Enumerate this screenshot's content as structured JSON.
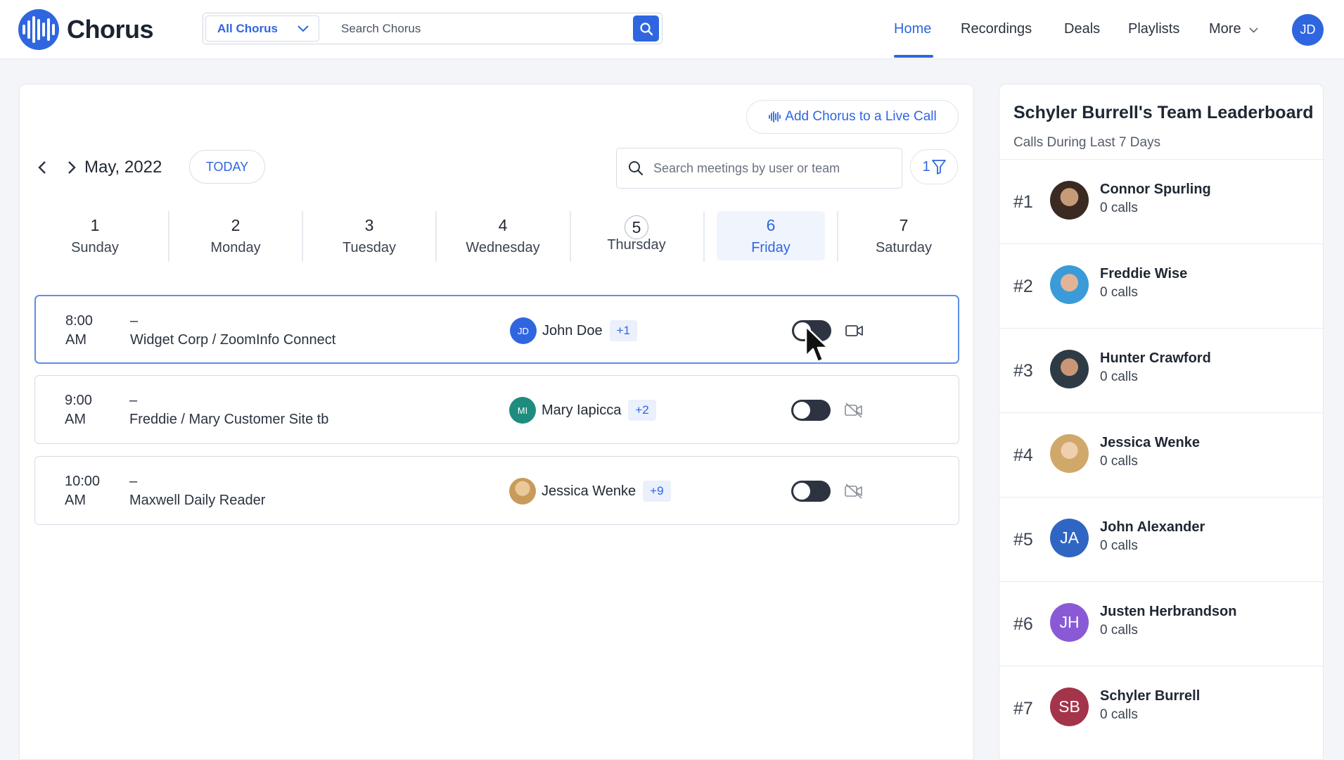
{
  "app": {
    "name": "Chorus",
    "user_initials": "JD"
  },
  "search": {
    "scope": "All Chorus",
    "placeholder": "Search Chorus"
  },
  "nav": {
    "items": [
      {
        "label": "Home",
        "active": true
      },
      {
        "label": "Recordings",
        "active": false
      },
      {
        "label": "Deals",
        "active": false
      },
      {
        "label": "Playlists",
        "active": false
      },
      {
        "label": "More",
        "active": false
      }
    ]
  },
  "calendar": {
    "add_live_call_label": "Add Chorus to a Live Call",
    "month_label": "May, 2022",
    "today_label": "TODAY",
    "meeting_search_placeholder": "Search meetings by user or team",
    "filter_count": "1",
    "days": [
      {
        "num": "1",
        "name": "Sunday"
      },
      {
        "num": "2",
        "name": "Monday"
      },
      {
        "num": "3",
        "name": "Tuesday"
      },
      {
        "num": "4",
        "name": "Wednesday"
      },
      {
        "num": "5",
        "name": "Thursday",
        "today": true
      },
      {
        "num": "6",
        "name": "Friday",
        "selected": true
      },
      {
        "num": "7",
        "name": "Saturday"
      }
    ]
  },
  "meetings": [
    {
      "time": "8:00",
      "ampm": "AM",
      "dash": "–",
      "title": "Widget Corp / ZoomInfo Connect",
      "person": "John Doe",
      "initials": "JD",
      "avatar_color": "#2f66e0",
      "extra": "+1",
      "recording": true
    },
    {
      "time": "9:00",
      "ampm": "AM",
      "dash": "–",
      "title": "Freddie / Mary Customer Site tb",
      "person": "Mary Iapicca",
      "initials": "MI",
      "avatar_color": "#1e8c7e",
      "extra": "+2",
      "recording": false
    },
    {
      "time": "10:00",
      "ampm": "AM",
      "dash": "–",
      "title": "Maxwell Daily Reader",
      "person": "Jessica Wenke",
      "initials": "",
      "avatar_color": "#d9b27a",
      "extra": "+9",
      "recording": false
    }
  ],
  "leaderboard": {
    "title": "Schyler Burrell's Team Leaderboard",
    "subtitle": "Calls During Last 7 Days",
    "entries": [
      {
        "rank": "#1",
        "name": "Connor Spurling",
        "calls": "0 calls",
        "initials": "",
        "color": "#6b4a3a"
      },
      {
        "rank": "#2",
        "name": "Freddie Wise",
        "calls": "0 calls",
        "initials": "",
        "color": "#3b9bd8"
      },
      {
        "rank": "#3",
        "name": "Hunter Crawford",
        "calls": "0 calls",
        "initials": "",
        "color": "#2e3b44"
      },
      {
        "rank": "#4",
        "name": "Jessica Wenke",
        "calls": "0 calls",
        "initials": "",
        "color": "#d9b27a"
      },
      {
        "rank": "#5",
        "name": "John Alexander",
        "calls": "0 calls",
        "initials": "JA",
        "color": "#2f66c4"
      },
      {
        "rank": "#6",
        "name": "Justen Herbrandson",
        "calls": "0 calls",
        "initials": "JH",
        "color": "#8a5ad6"
      },
      {
        "rank": "#7",
        "name": "Schyler Burrell",
        "calls": "0 calls",
        "initials": "SB",
        "color": "#a3344a"
      }
    ]
  }
}
